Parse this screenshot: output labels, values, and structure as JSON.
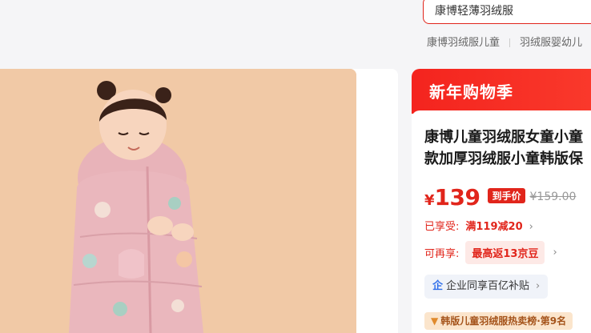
{
  "search": {
    "value": "康博轻薄羽绒服"
  },
  "hot_words": [
    "康博羽绒服儿童",
    "羽绒服婴幼儿"
  ],
  "banner": {
    "text": "新年购物季"
  },
  "product": {
    "title_line1": "康博儿童羽绒服女童小童",
    "title_line2": "款加厚羽绒服小童韩版保"
  },
  "price": {
    "currency": "¥",
    "value": "139",
    "tag": "到手价",
    "original": "¥159.00"
  },
  "promo": {
    "label": "已享受:",
    "value": "满119减20"
  },
  "bean": {
    "label": "可再享:",
    "value": "最高返13京豆"
  },
  "subsidy": {
    "icon": "企",
    "text": "企业同享百亿补贴"
  },
  "rank": {
    "text": "韩版儿童羽绒服热卖榜·第9名"
  },
  "colors": {
    "accent": "#e1251b",
    "image_bg": "#f1c9a6",
    "jacket": "#eab7bd"
  },
  "icons": [
    "chevron-right-icon",
    "enterprise-icon",
    "rank-medal-icon"
  ]
}
